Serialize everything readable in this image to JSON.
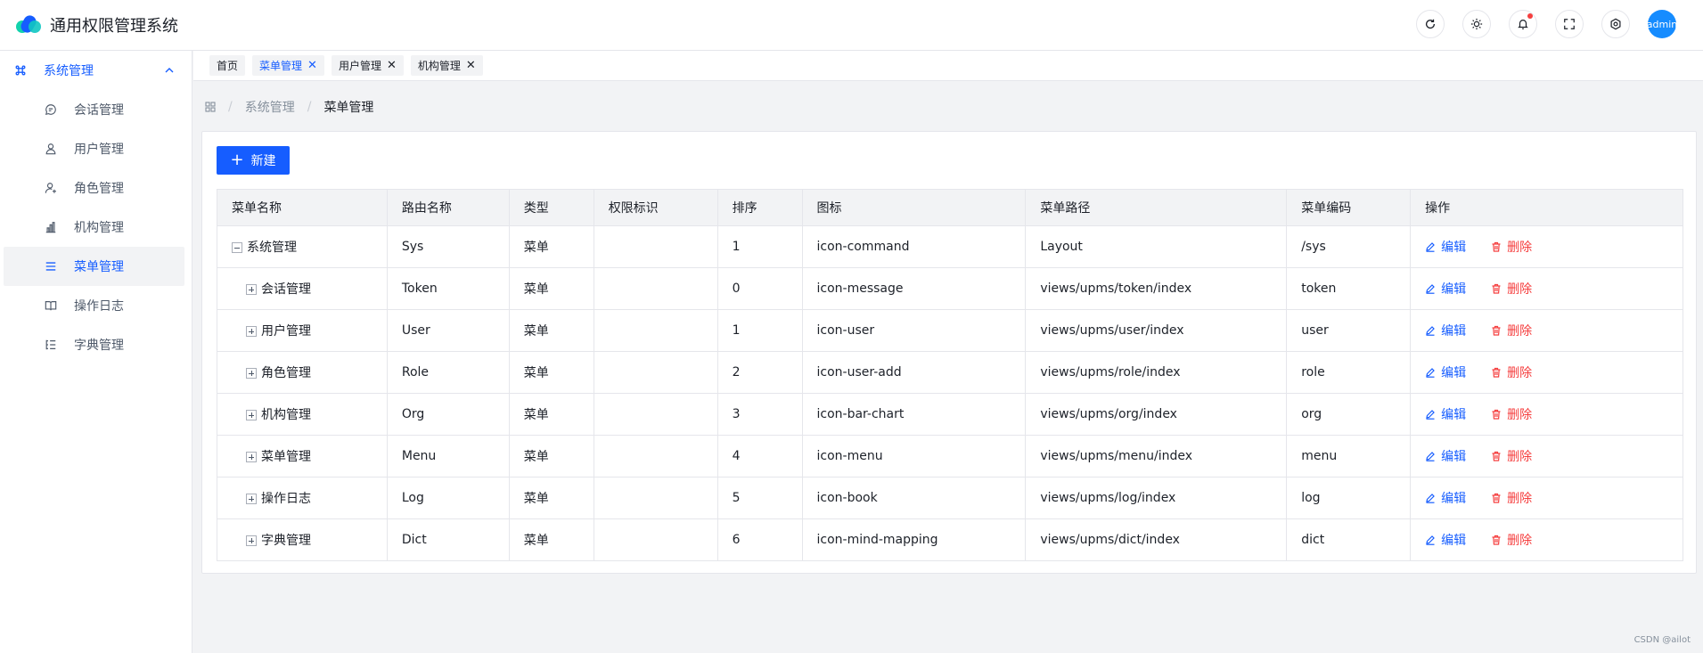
{
  "app": {
    "title": "通用权限管理系统"
  },
  "header": {
    "avatar_text": "admin"
  },
  "sidebar": {
    "group": {
      "label": "系统管理"
    },
    "items": [
      {
        "label": "会话管理",
        "icon": "message-icon"
      },
      {
        "label": "用户管理",
        "icon": "user-icon"
      },
      {
        "label": "角色管理",
        "icon": "user-add-icon"
      },
      {
        "label": "机构管理",
        "icon": "bar-chart-icon"
      },
      {
        "label": "菜单管理",
        "icon": "menu-icon",
        "active": true
      },
      {
        "label": "操作日志",
        "icon": "book-icon"
      },
      {
        "label": "字典管理",
        "icon": "mind-mapping-icon"
      }
    ]
  },
  "tabs": [
    {
      "label": "首页",
      "closable": false
    },
    {
      "label": "菜单管理",
      "closable": true,
      "active": true
    },
    {
      "label": "用户管理",
      "closable": true
    },
    {
      "label": "机构管理",
      "closable": true
    }
  ],
  "breadcrumb": {
    "parent": "系统管理",
    "current": "菜单管理"
  },
  "toolbar": {
    "new_label": "新建"
  },
  "table": {
    "columns": [
      "菜单名称",
      "路由名称",
      "类型",
      "权限标识",
      "排序",
      "图标",
      "菜单路径",
      "菜单编码",
      "操作"
    ],
    "actions": {
      "edit": "编辑",
      "delete": "删除"
    },
    "rows": [
      {
        "name": "系统管理",
        "route": "Sys",
        "type": "菜单",
        "perm": "",
        "sort": "1",
        "icon": "icon-command",
        "path": "Layout",
        "code": "/sys"
      },
      {
        "name": "会话管理",
        "route": "Token",
        "type": "菜单",
        "perm": "",
        "sort": "0",
        "icon": "icon-message",
        "path": "views/upms/token/index",
        "code": "token"
      },
      {
        "name": "用户管理",
        "route": "User",
        "type": "菜单",
        "perm": "",
        "sort": "1",
        "icon": "icon-user",
        "path": "views/upms/user/index",
        "code": "user"
      },
      {
        "name": "角色管理",
        "route": "Role",
        "type": "菜单",
        "perm": "",
        "sort": "2",
        "icon": "icon-user-add",
        "path": "views/upms/role/index",
        "code": "role"
      },
      {
        "name": "机构管理",
        "route": "Org",
        "type": "菜单",
        "perm": "",
        "sort": "3",
        "icon": "icon-bar-chart",
        "path": "views/upms/org/index",
        "code": "org"
      },
      {
        "name": "菜单管理",
        "route": "Menu",
        "type": "菜单",
        "perm": "",
        "sort": "4",
        "icon": "icon-menu",
        "path": "views/upms/menu/index",
        "code": "menu"
      },
      {
        "name": "操作日志",
        "route": "Log",
        "type": "菜单",
        "perm": "",
        "sort": "5",
        "icon": "icon-book",
        "path": "views/upms/log/index",
        "code": "log"
      },
      {
        "name": "字典管理",
        "route": "Dict",
        "type": "菜单",
        "perm": "",
        "sort": "6",
        "icon": "icon-mind-mapping",
        "path": "views/upms/dict/index",
        "code": "dict"
      }
    ]
  },
  "footer": {
    "note": "CSDN @ailot"
  },
  "colors": {
    "primary": "#165dff",
    "danger": "#f53f3f",
    "avatar": "#168cff"
  }
}
